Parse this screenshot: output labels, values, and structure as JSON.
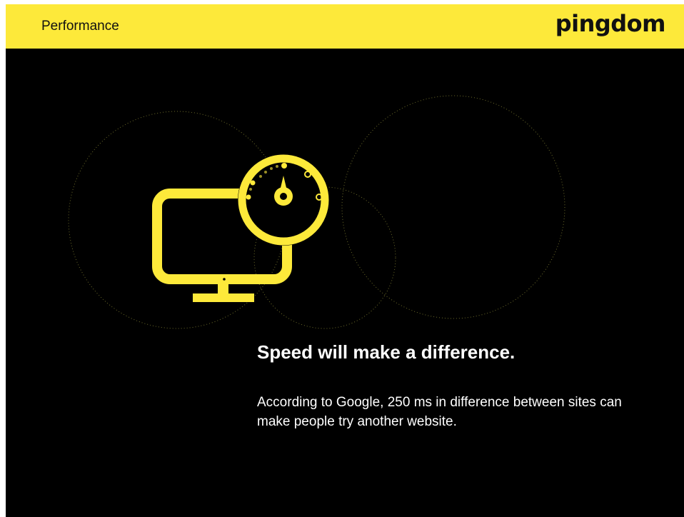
{
  "header": {
    "section_title": "Performance",
    "brand": "pingdom"
  },
  "content": {
    "headline": "Speed will make a difference.",
    "body": "According to Google, 250 ms in difference between sites can make people try another website."
  },
  "icons": [
    "monitor-icon",
    "speedometer-icon"
  ],
  "colors": {
    "accent": "#fde93a",
    "background": "#000000",
    "text": "#ffffff"
  }
}
